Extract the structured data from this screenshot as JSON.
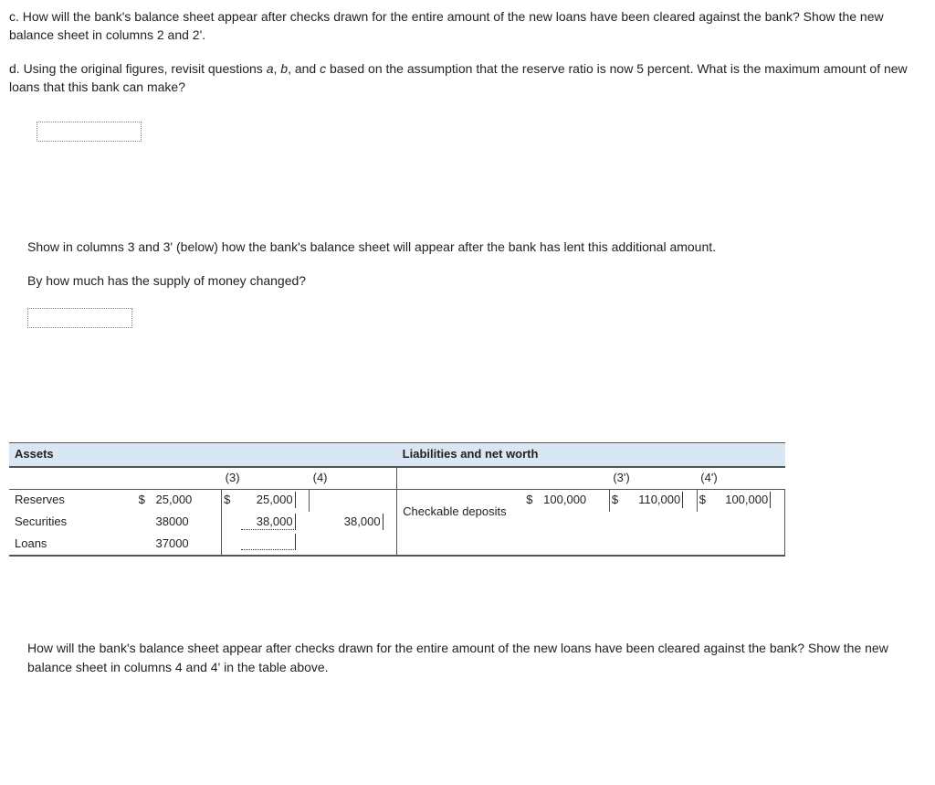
{
  "text": {
    "para_c": "c. How will the bank's balance sheet appear after checks drawn for the entire amount of the new loans have been cleared against the bank? Show the new balance sheet in columns 2 and 2'.",
    "para_d_pre": "d. Using the original figures, revisit questions ",
    "para_d_a": "a",
    "para_d_mid1": ", ",
    "para_d_b": "b",
    "para_d_mid2": ", and ",
    "para_d_c": "c",
    "para_d_post": " based on the assumption that the reserve ratio is now 5 percent. What is the maximum amount of new loans that this bank can make?",
    "para_show": "Show in columns 3 and 3' (below) how the bank's balance sheet will appear after the bank has lent this additional amount.",
    "para_supply": "By how much has the supply of money changed?",
    "para_final": "How will the bank's balance sheet appear after checks drawn for the entire amount of the new loans have been cleared against the bank? Show the new balance sheet in columns 4 and 4' in the table above."
  },
  "table": {
    "hdr_assets": "Assets",
    "hdr_liab": "Liabilities and net worth",
    "col3": "(3)",
    "col4": "(4)",
    "col3p": "(3')",
    "col4p": "(4')",
    "row_reserves": "Reserves",
    "row_securities": "Securities",
    "row_loans": "Loans",
    "row_checkable": "Checkable deposits",
    "cur": "$",
    "vals": {
      "reserves_base": "25,000",
      "reserves_3": "25,000",
      "securities_base": "38000",
      "securities_3": "38,000",
      "securities_4": "38,000",
      "loans_base": "37000",
      "checkable_base": "100,000",
      "checkable_3p": "110,000",
      "checkable_4p": "100,000"
    }
  }
}
